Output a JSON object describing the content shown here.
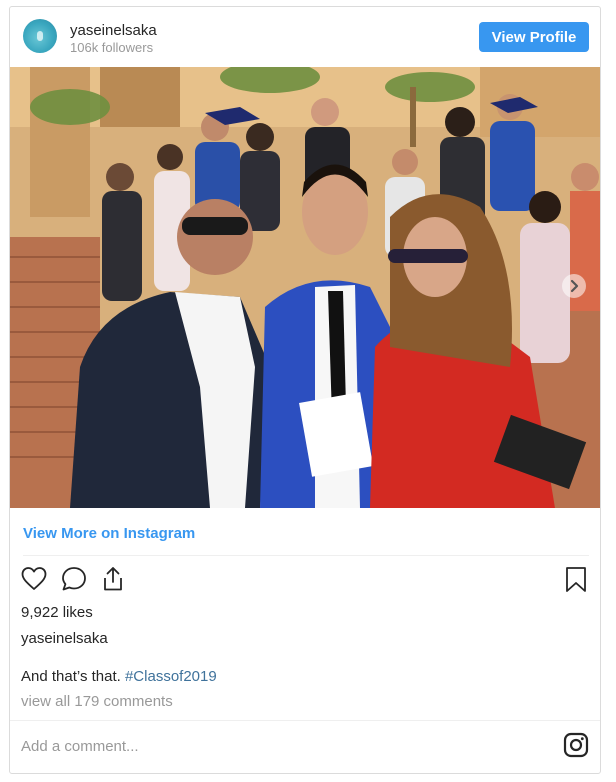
{
  "header": {
    "username": "yaseinelsaka",
    "followers": "106k followers",
    "view_profile_label": "View Profile"
  },
  "post": {
    "view_more_label": "View More on Instagram",
    "likes": "9,922 likes",
    "caption_username": "yaseinelsaka",
    "caption_text": "And that’s that. ",
    "caption_hashtag": "#Classof2019",
    "comments_link": "view all 179 comments"
  },
  "comment_box": {
    "placeholder": "Add a comment..."
  },
  "icons": {
    "like": "heart-icon",
    "comment": "comment-icon",
    "share": "share-icon",
    "save": "bookmark-icon",
    "next": "chevron-right-icon",
    "instagram": "instagram-icon"
  },
  "colors": {
    "accent": "#3897f0",
    "hashtag": "#3f729b",
    "muted": "#999999"
  }
}
